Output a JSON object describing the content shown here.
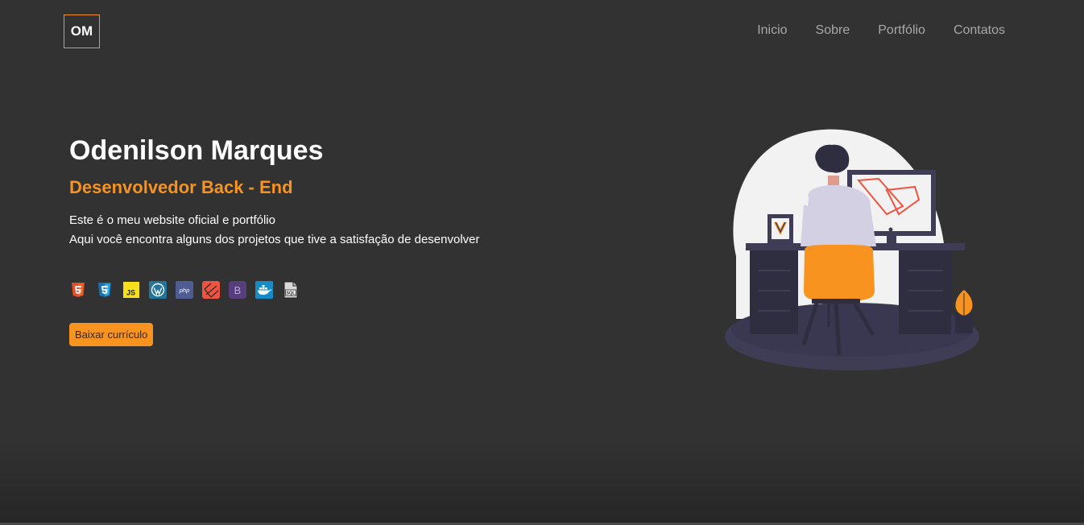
{
  "header": {
    "logo": "OM",
    "nav": [
      "Inicio",
      "Sobre",
      "Portfólio",
      "Contatos"
    ]
  },
  "hero": {
    "name": "Odenilson Marques",
    "role": "Desenvolvedor Back - End",
    "desc_line1": "Este é o meu website oficial e portfólio",
    "desc_line2": "Aqui você encontra alguns dos projetos que tive a satisfação de desenvolver",
    "cv_button": "Baixar currículo"
  },
  "tech_icons": [
    "html5-icon",
    "css3-icon",
    "javascript-icon",
    "wordpress-icon",
    "php-icon",
    "laravel-icon",
    "bootstrap-icon",
    "docker-icon",
    "sql-icon"
  ],
  "tech_text": {
    "js": "JS",
    "php": "php",
    "bootstrap": "B",
    "sql": "SQL"
  },
  "colors": {
    "accent": "#f7931e",
    "background": "#323232",
    "nav_text": "#a8a8a8"
  }
}
